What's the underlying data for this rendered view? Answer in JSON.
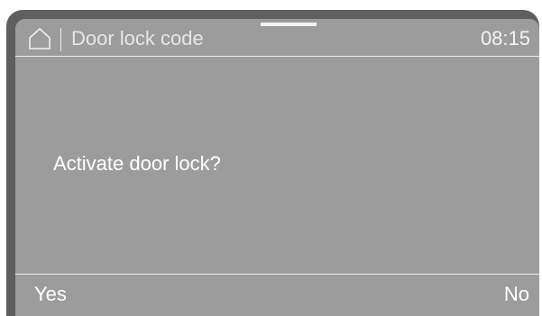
{
  "header": {
    "icon": "home-icon",
    "title": "Door lock code",
    "time": "08:15"
  },
  "dialog": {
    "question": "Activate door lock?"
  },
  "footer": {
    "yes_label": "Yes",
    "no_label": "No"
  },
  "colors": {
    "bezel": "#5f5f5f",
    "screen": "#9c9c9c",
    "text": "#ffffff",
    "lines": "#eeeeee"
  }
}
